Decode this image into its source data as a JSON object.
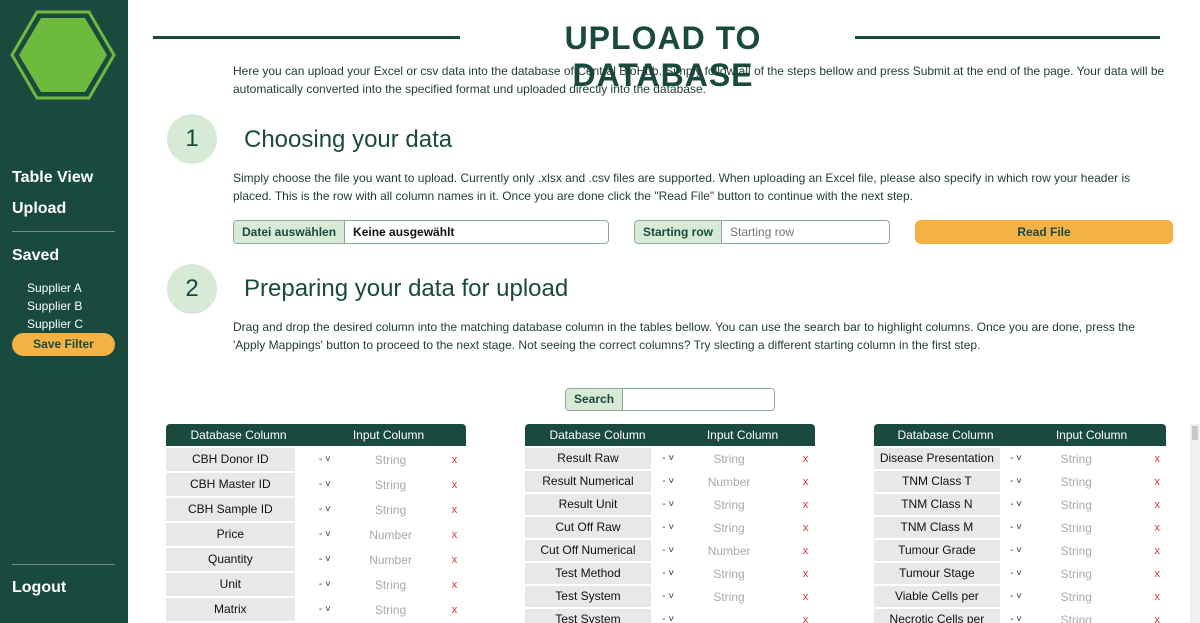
{
  "sidebar": {
    "nav": {
      "table_view": "Table View",
      "upload": "Upload",
      "saved": "Saved",
      "logout": "Logout"
    },
    "saved_items": [
      "Supplier A",
      "Supplier B",
      "Supplier C"
    ],
    "save_filter": "Save Filter"
  },
  "header": {
    "title": "UPLOAD TO DATABASE",
    "intro": "Here you can upload your Excel or csv data into the database of Central BioHub. Simply follow all of the steps bellow and press Submit at the end of the page. Your data will be automatically converted into the specified format und uploaded directly into the database."
  },
  "step1": {
    "number": "1",
    "title": "Choosing your data",
    "description": "Simply choose the file you want to upload. Currently only .xlsx and .csv files are supported. When uploading an Excel file, please also specify in which row your header is placed. This is the row with all column names in it. Once you are done click the \"Read File\" button to continue with the next step.",
    "file_button": "Datei auswählen",
    "file_value": "Keine ausgewählt",
    "starting_row_label": "Starting row",
    "starting_row_placeholder": "Starting row",
    "read_file": "Read File"
  },
  "step2": {
    "number": "2",
    "title": "Preparing your data for upload",
    "description": "Drag and drop the desired column into the matching database column in the tables bellow. You can use the search bar to highlight columns. Once you are done, press the 'Apply Mappings' button to proceed to the next stage. Not seeing the correct columns? Try slecting a different starting column in the first step.",
    "search_label": "Search"
  },
  "table_headers": {
    "db": "Database Column",
    "input": "Input Column"
  },
  "select_symbol": "- ˅",
  "remove_symbol": "x",
  "tables": [
    {
      "rows": [
        {
          "db": "CBH Donor ID",
          "input": "String"
        },
        {
          "db": "CBH Master ID",
          "input": "String"
        },
        {
          "db": "CBH Sample ID",
          "input": "String"
        },
        {
          "db": "Price",
          "input": "Number"
        },
        {
          "db": "Quantity",
          "input": "Number"
        },
        {
          "db": "Unit",
          "input": "String"
        },
        {
          "db": "Matrix",
          "input": "String"
        }
      ]
    },
    {
      "rows": [
        {
          "db": "Result Raw",
          "input": "String"
        },
        {
          "db": "Result Numerical",
          "input": "Number"
        },
        {
          "db": "Result Unit",
          "input": "String"
        },
        {
          "db": "Cut Off Raw",
          "input": "String"
        },
        {
          "db": "Cut Off Numerical",
          "input": "Number"
        },
        {
          "db": "Test Method",
          "input": "String"
        },
        {
          "db": "Test System",
          "input": "String"
        },
        {
          "db": "Test System",
          "input": ""
        }
      ]
    },
    {
      "rows": [
        {
          "db": "Disease Presentation",
          "input": "String"
        },
        {
          "db": "TNM Class T",
          "input": "String"
        },
        {
          "db": "TNM Class N",
          "input": "String"
        },
        {
          "db": "TNM Class M",
          "input": "String"
        },
        {
          "db": "Tumour Grade",
          "input": "String"
        },
        {
          "db": "Tumour Stage",
          "input": "String"
        },
        {
          "db": "Viable Cells per",
          "input": "String"
        },
        {
          "db": "Necrotic Cells per",
          "input": "String"
        }
      ]
    }
  ]
}
